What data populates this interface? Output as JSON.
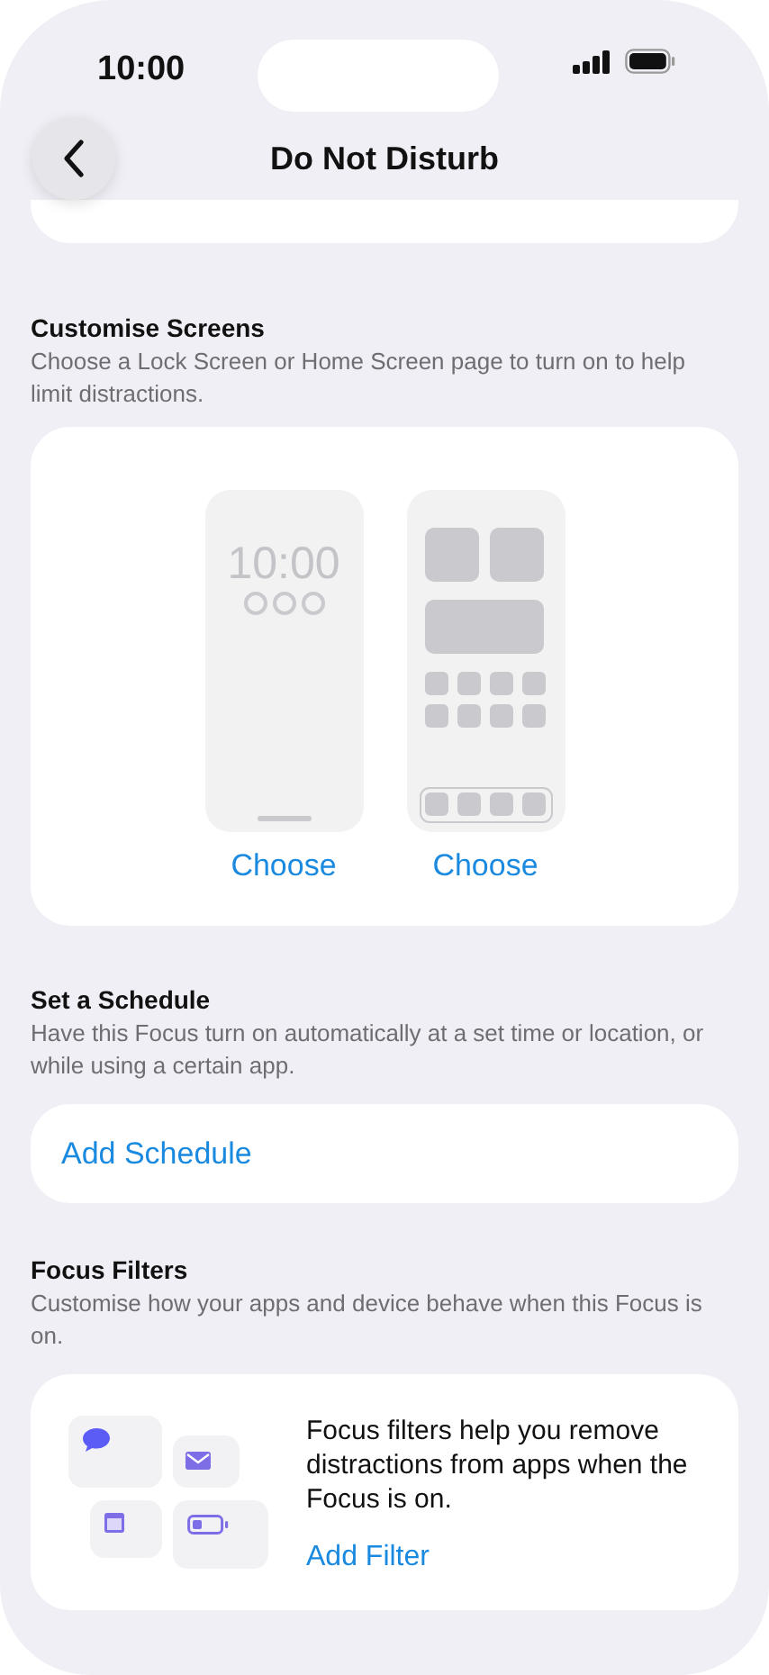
{
  "status_bar": {
    "time": "10:00"
  },
  "nav": {
    "title": "Do Not Disturb"
  },
  "customise": {
    "title": "Customise Screens",
    "description": "Choose a Lock Screen or Home Screen page to turn on to help limit distractions.",
    "screens": [
      {
        "kind": "lock",
        "clock": "10:00",
        "action": "Choose"
      },
      {
        "kind": "home",
        "action": "Choose"
      }
    ]
  },
  "schedule": {
    "title": "Set a Schedule",
    "description": "Have this Focus turn on automatically at a set time or location, or while using a certain app.",
    "action": "Add Schedule"
  },
  "filters": {
    "title": "Focus Filters",
    "description": "Customise how your apps and device behave when this Focus is on.",
    "body": "Focus filters help you remove distractions from apps when the Focus is on.",
    "action": "Add Filter"
  }
}
